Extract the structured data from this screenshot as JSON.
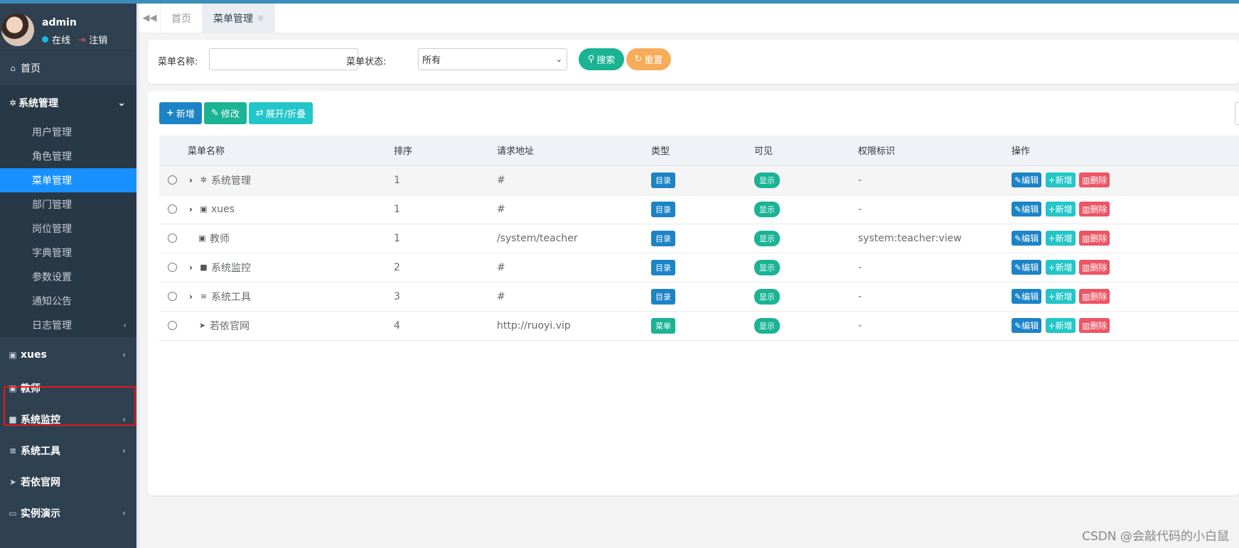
{
  "user": {
    "name": "admin",
    "status": "在线",
    "logout": "注销"
  },
  "sidebar": {
    "home": "首页",
    "system_group": "系统管理",
    "system_items": [
      "用户管理",
      "角色管理",
      "菜单管理",
      "部门管理",
      "岗位管理",
      "字典管理",
      "参数设置",
      "通知公告",
      "日志管理"
    ],
    "active_item": "菜单管理",
    "other_items": [
      "xues",
      "教师",
      "系统监控",
      "系统工具",
      "若依官网",
      "实例演示"
    ],
    "highlighted": "教师"
  },
  "tabs": [
    {
      "label": "首页",
      "active": false
    },
    {
      "label": "菜单管理",
      "active": true
    }
  ],
  "search": {
    "name_label": "菜单名称:",
    "name_value": "",
    "status_label": "菜单状态:",
    "status_value": "所有",
    "search_btn": "搜索",
    "reset_btn": "重置"
  },
  "toolbar": {
    "add": "新增",
    "edit": "修改",
    "toggle": "展开/折叠"
  },
  "table": {
    "columns": [
      "菜单名称",
      "排序",
      "请求地址",
      "类型",
      "可见",
      "权限标识",
      "操作"
    ],
    "rows": [
      {
        "name": "系统管理",
        "icon": "gear-icon",
        "expandable": true,
        "order": "1",
        "url": "#",
        "type": "目录",
        "visible": "显示",
        "perm": "-"
      },
      {
        "name": "xues",
        "icon": "address-card-icon",
        "expandable": true,
        "order": "1",
        "url": "#",
        "type": "目录",
        "visible": "显示",
        "perm": "-"
      },
      {
        "name": "教师",
        "icon": "address-card-icon",
        "expandable": false,
        "order": "1",
        "url": "/system/teacher",
        "type": "目录",
        "visible": "显示",
        "perm": "system:teacher:view"
      },
      {
        "name": "系统监控",
        "icon": "video-icon",
        "expandable": true,
        "order": "2",
        "url": "#",
        "type": "目录",
        "visible": "显示",
        "perm": "-"
      },
      {
        "name": "系统工具",
        "icon": "bars-icon",
        "expandable": true,
        "order": "3",
        "url": "#",
        "type": "目录",
        "visible": "显示",
        "perm": "-"
      },
      {
        "name": "若依官网",
        "icon": "location-arrow-icon",
        "expandable": false,
        "order": "4",
        "url": "http://ruoyi.vip",
        "type": "菜单",
        "visible": "显示",
        "perm": "-"
      }
    ],
    "actions": {
      "edit": "编辑",
      "add": "新增",
      "delete": "删除"
    }
  },
  "watermark": "CSDN @会敲代码的小白鼠"
}
